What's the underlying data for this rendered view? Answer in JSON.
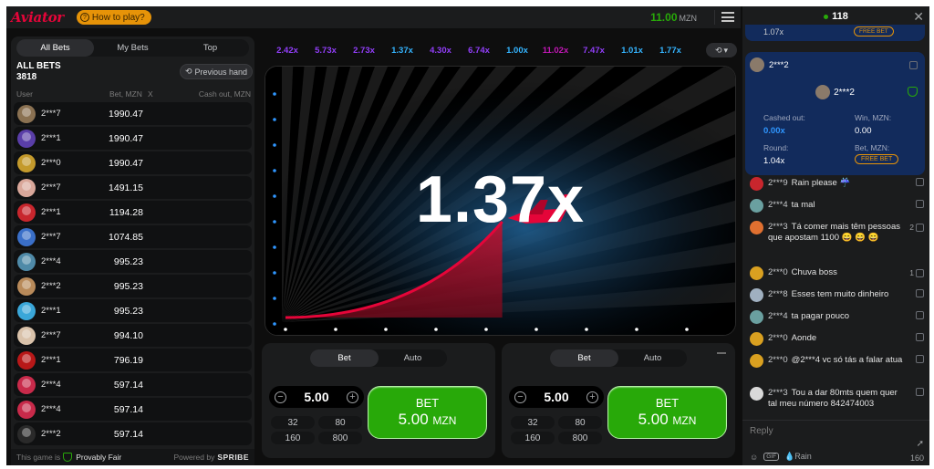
{
  "header": {
    "logo": "Aviator",
    "how_to_play": "How to play?",
    "balance": "11.00",
    "currency": "MZN"
  },
  "bets_panel": {
    "tabs": [
      "All Bets",
      "My Bets",
      "Top"
    ],
    "all_bets_label": "ALL BETS",
    "all_bets_count": "3818",
    "previous_hand": "Previous hand",
    "columns": {
      "user": "User",
      "bet": "Bet, MZN",
      "x": "X",
      "cashout": "Cash out, MZN"
    },
    "rows": [
      {
        "user": "2***7",
        "bet": "1990.47",
        "color": "#8a7152"
      },
      {
        "user": "2***1",
        "bet": "1990.47",
        "color": "#5a3ea8"
      },
      {
        "user": "2***0",
        "bet": "1990.47",
        "color": "#c49a2c"
      },
      {
        "user": "2***7",
        "bet": "1491.15",
        "color": "#d9a79a"
      },
      {
        "user": "2***1",
        "bet": "1194.28",
        "color": "#c8262d"
      },
      {
        "user": "2***7",
        "bet": "1074.85",
        "color": "#3a6fc8"
      },
      {
        "user": "2***4",
        "bet": "995.23",
        "color": "#4f8aa8"
      },
      {
        "user": "2***2",
        "bet": "995.23",
        "color": "#b88a5a"
      },
      {
        "user": "2***1",
        "bet": "995.23",
        "color": "#3aa7d9"
      },
      {
        "user": "2***7",
        "bet": "994.10",
        "color": "#d9c2aa"
      },
      {
        "user": "2***1",
        "bet": "796.19",
        "color": "#b81818"
      },
      {
        "user": "2***4",
        "bet": "597.14",
        "color": "#c82a4a"
      },
      {
        "user": "2***4",
        "bet": "597.14",
        "color": "#c82a4a"
      },
      {
        "user": "2***2",
        "bet": "597.14",
        "color": "#2a2a2a"
      }
    ],
    "footer": {
      "provably_prefix": "This game is",
      "provably_fair": "Provably Fair",
      "powered_by": "Powered by",
      "brand": "SPRIBE"
    }
  },
  "history": [
    {
      "v": "2.42x",
      "color": "#913ef8"
    },
    {
      "v": "5.73x",
      "color": "#913ef8"
    },
    {
      "v": "2.73x",
      "color": "#913ef8"
    },
    {
      "v": "1.37x",
      "color": "#34b4ff"
    },
    {
      "v": "4.30x",
      "color": "#913ef8"
    },
    {
      "v": "6.74x",
      "color": "#913ef8"
    },
    {
      "v": "1.00x",
      "color": "#34b4ff"
    },
    {
      "v": "11.02x",
      "color": "#c017b4"
    },
    {
      "v": "7.47x",
      "color": "#913ef8"
    },
    {
      "v": "1.01x",
      "color": "#34b4ff"
    },
    {
      "v": "1.77x",
      "color": "#34b4ff"
    }
  ],
  "game": {
    "multiplier": "1.37x",
    "curve_progress": 0.52,
    "plane_color": "#e50539"
  },
  "bet_panels": [
    {
      "tabs": [
        "Bet",
        "Auto"
      ],
      "amount": "5.00",
      "quick": [
        "32",
        "80",
        "160",
        "800"
      ],
      "button_label": "BET",
      "button_amount": "5.00",
      "button_currency": "MZN"
    },
    {
      "tabs": [
        "Bet",
        "Auto"
      ],
      "amount": "5.00",
      "quick": [
        "32",
        "80",
        "160",
        "800"
      ],
      "button_label": "BET",
      "button_amount": "5.00",
      "button_currency": "MZN"
    }
  ],
  "chat": {
    "online": "118",
    "prev_card_value": "1.07x",
    "free_bet": "FREE BET",
    "share": {
      "user": "2***2",
      "cashed_label": "Cashed out:",
      "cashed_value": "0.00x",
      "win_label": "Win, MZN:",
      "win_value": "0.00",
      "round_label": "Round:",
      "round_value": "1.04x",
      "bet_label": "Bet, MZN:",
      "bet_value": "FREE BET"
    },
    "messages": [
      {
        "user": "2***9",
        "text": "Rain please ☔",
        "likes": "",
        "color": "#c8262d",
        "h": 24
      },
      {
        "user": "2***4",
        "text": "ta mal",
        "likes": "",
        "color": "#6aa0a0",
        "h": 24
      },
      {
        "user": "2***3",
        "text": "Tá comer mais têm pessoas que apostam 1100 😄 😄 😄",
        "likes": "2",
        "color": "#e07030",
        "h": 50
      },
      {
        "user": "2***0",
        "text": "Chuva boss",
        "likes": "1",
        "color": "#d9a020",
        "h": 24
      },
      {
        "user": "2***8",
        "text": "Esses tem muito dinheiro",
        "likes": "",
        "color": "#a0b0c0",
        "h": 24
      },
      {
        "user": "2***4",
        "text": "ta pagar pouco",
        "likes": "",
        "color": "#6aa0a0",
        "h": 24
      },
      {
        "user": "2***0",
        "text": "Aonde",
        "likes": "",
        "color": "#d9a020",
        "h": 24
      },
      {
        "user": "2***0",
        "text": "@2***4 vc só tás a falar atua",
        "likes": "",
        "color": "#d9a020",
        "h": 36
      },
      {
        "user": "2***3",
        "text": "Tou a dar 80mts quem quer tal meu número 842474003",
        "likes": "",
        "color": "#d9d9d9",
        "h": 36
      }
    ],
    "reply_placeholder": "Reply",
    "gif": "GIF",
    "rain": "Rain",
    "char_count": "160"
  }
}
